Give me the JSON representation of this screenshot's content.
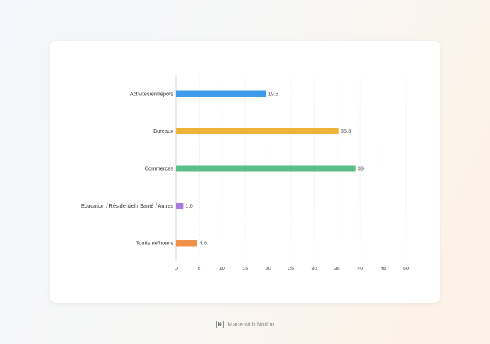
{
  "chart_data": {
    "type": "bar",
    "orientation": "horizontal",
    "categories": [
      "Activités/entrepôts",
      "Bureaux",
      "Commerces",
      "Education / Résidentiel / Santé / Autres",
      "Tourisme/hotels"
    ],
    "values": [
      19.5,
      35.3,
      39,
      1.6,
      4.6
    ],
    "value_labels": [
      "19.5",
      "35.3",
      "39",
      "1.6",
      "4.6"
    ],
    "colors": [
      "#3d9be9",
      "#ecb53a",
      "#5bbf8a",
      "#a77ade",
      "#f0914a"
    ],
    "xlim": [
      0,
      50
    ],
    "x_ticks": [
      0,
      5,
      10,
      15,
      20,
      25,
      30,
      35,
      40,
      45,
      50
    ],
    "grid": true,
    "title": "",
    "xlabel": "",
    "ylabel": ""
  },
  "footer": {
    "text": "Made with Notion",
    "logo_icon": "notion-logo-icon"
  }
}
